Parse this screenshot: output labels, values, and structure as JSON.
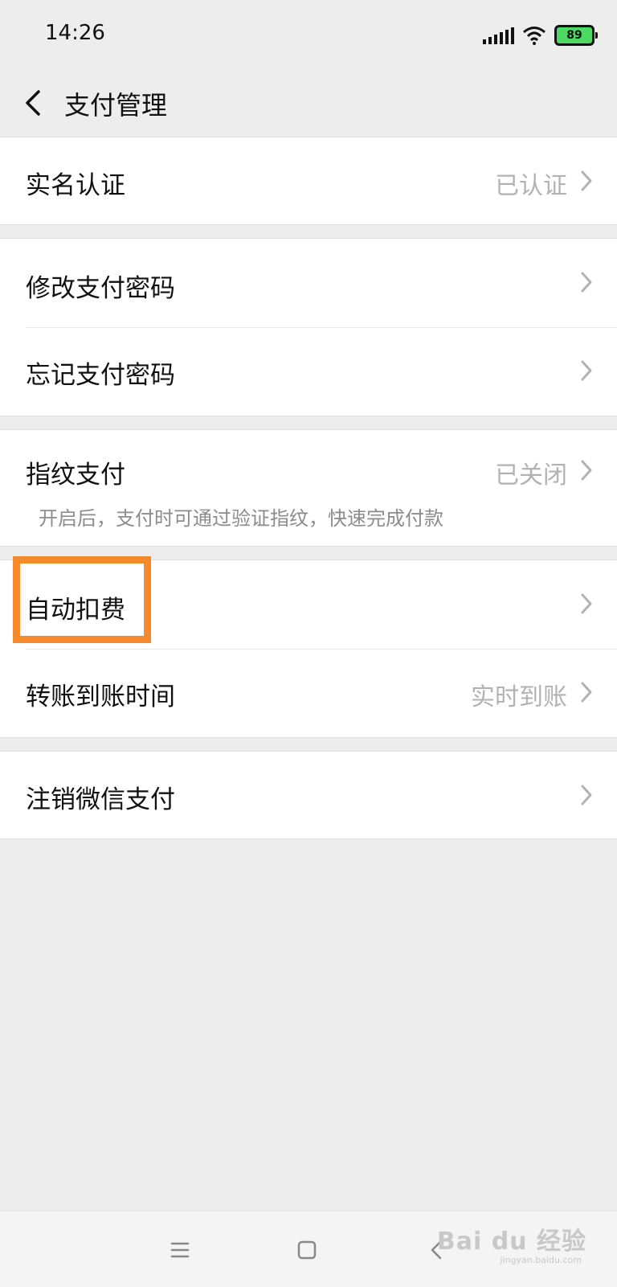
{
  "status_bar": {
    "time": "14:26",
    "battery": "89",
    "icons": [
      "signal-icon",
      "wifi-icon",
      "battery-icon"
    ],
    "battery_color": "#4cd964"
  },
  "nav": {
    "title": "支付管理",
    "back_icon": "back-arrow-icon"
  },
  "groups": [
    {
      "rows": [
        {
          "label": "实名认证",
          "value": "已认证"
        }
      ]
    },
    {
      "rows": [
        {
          "label": "修改支付密码",
          "value": ""
        },
        {
          "label": "忘记支付密码",
          "value": ""
        }
      ]
    },
    {
      "rows": [
        {
          "label": "指纹支付",
          "value": "已关闭",
          "subtitle": "开启后，支付时可通过验证指纹，快速完成付款"
        }
      ]
    },
    {
      "rows": [
        {
          "label": "自动扣费",
          "value": ""
        },
        {
          "label": "转账到账时间",
          "value": "实时到账"
        }
      ]
    },
    {
      "rows": [
        {
          "label": "注销微信支付",
          "value": ""
        }
      ]
    }
  ],
  "highlight_color": "#f58a2c",
  "system_nav": {
    "icons": [
      "menu-icon",
      "home-icon",
      "back-icon"
    ]
  },
  "watermark": {
    "text": "Bai du 经验",
    "sub": "jingyan.baidu.com"
  }
}
